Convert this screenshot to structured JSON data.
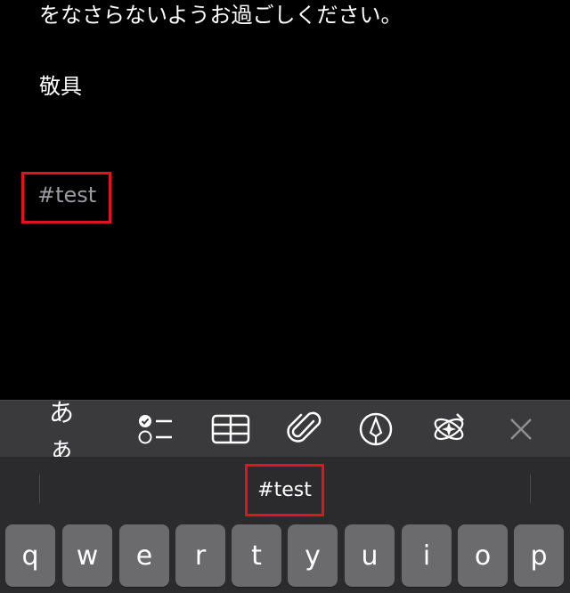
{
  "note": {
    "line1": "をなさらないようお過ごしください。",
    "line2": "敬具",
    "tag": "#test"
  },
  "format_bar": {
    "text_style_label": "あぁ",
    "icons": [
      "checklist-icon",
      "table-icon",
      "paperclip-icon",
      "markup-pen-icon",
      "ai-sparkle-icon",
      "close-icon"
    ]
  },
  "suggestions": {
    "center": "#test"
  },
  "keyboard": {
    "row1": [
      "q",
      "w",
      "e",
      "r",
      "t",
      "y",
      "u",
      "i",
      "o",
      "p"
    ]
  },
  "colors": {
    "highlight": "#e0141e",
    "tag_text": "#9a9aa0",
    "toolbar_bg": "#3a3a3c",
    "keyboard_bg": "#2b2b2d",
    "key_bg": "#6b6b6e"
  }
}
